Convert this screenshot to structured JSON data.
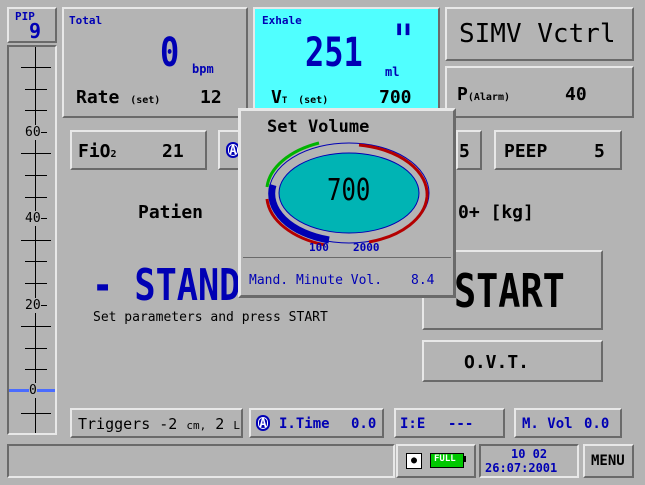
{
  "pip": {
    "label": "PIP",
    "value": "9"
  },
  "gauge": {
    "labels": [
      "60",
      "40",
      "20",
      "0"
    ],
    "pressure_level": 0
  },
  "total": {
    "label": "Total",
    "value": "0",
    "unit": "bpm",
    "set_label": "Rate",
    "set_sub": "(set)",
    "set_value": "12"
  },
  "exhale": {
    "label": "Exhale",
    "value": "251",
    "unit": "ml",
    "set_label": "V",
    "set_sub_t": "T",
    "set_sub": "(set)",
    "set_value": "700"
  },
  "mode": {
    "label": "SIMV Vctrl"
  },
  "alarm": {
    "label": "P",
    "sub": "(Alarm)",
    "value": "40"
  },
  "fio2": {
    "label": "FiO",
    "sub": "2",
    "value": "21"
  },
  "hidden_param": {
    "value": "5"
  },
  "peep": {
    "label": "PEEP",
    "value": "5"
  },
  "patient": {
    "left": "Patien",
    "right": "0+ [kg]"
  },
  "standby": {
    "title": "- STAND",
    "hint": "Set parameters and press START"
  },
  "start_button": {
    "label": "START"
  },
  "ovt_button": {
    "label": "O.V.T."
  },
  "bottom": {
    "triggers_label": "Triggers -2",
    "triggers_unit": "cm,",
    "triggers_val": "2",
    "triggers_unit2": "L",
    "itime_badge": "A",
    "itime_label": "I.Time",
    "itime_value": "0.0",
    "ie_label": "I:E",
    "ie_value": "---",
    "mvol_label": "M. Vol",
    "mvol_value": "0.0"
  },
  "fio_badge": "A",
  "status": {
    "battery": "FULL",
    "time": "10 02",
    "date": "26:07:2001",
    "menu": "MENU"
  },
  "dialog": {
    "title": "Set Volume",
    "value": "700",
    "min": "100",
    "max": "2000",
    "footer_label": "Mand. Minute Vol.",
    "footer_value": "8.4"
  },
  "colors": {
    "bg": "#b4b4b4",
    "blue": "#0000b4",
    "cyan": "#00ffff",
    "dial": "#00b4b4",
    "red": "#b40000",
    "green": "#00b400"
  }
}
